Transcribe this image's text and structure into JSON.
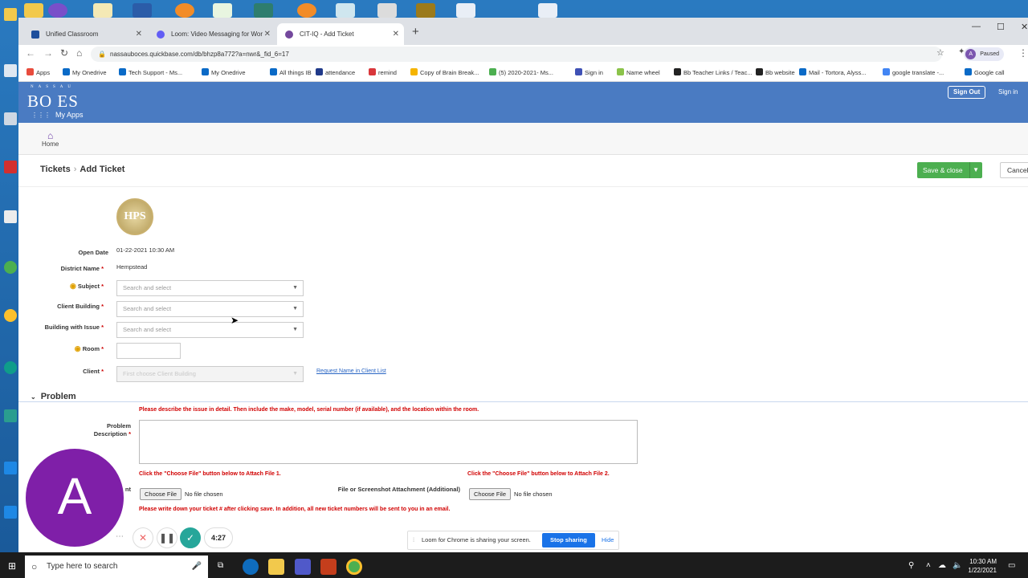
{
  "browser": {
    "tabs": [
      {
        "title": "Unified Classroom",
        "color": "#1e4f9c"
      },
      {
        "title": "Loom: Video Messaging for Wor",
        "color": "#625df5"
      },
      {
        "title": "CIT-IQ - Add Ticket",
        "color": "#74489d"
      }
    ],
    "url": "nassauboces.quickbase.com/db/bhzp8a772?a=nwr&_fid_6=17",
    "profile_initial": "A",
    "profile_label": "Paused",
    "bookmarks": [
      {
        "label": "Apps",
        "color": "#e84c3d"
      },
      {
        "label": "My Onedrive",
        "color": "#0a6ac7"
      },
      {
        "label": "Tech Support - Ms...",
        "color": "#0a6ac7"
      },
      {
        "label": "My Onedrive",
        "color": "#0a6ac7"
      },
      {
        "label": "All things IB",
        "color": "#0a6ac7"
      },
      {
        "label": "attendance",
        "color": "#203a8a"
      },
      {
        "label": "remind",
        "color": "#d9373b"
      },
      {
        "label": "Copy of Brain Break...",
        "color": "#f5b400"
      },
      {
        "label": "(5) 2020-2021- Ms...",
        "color": "#4caf50"
      },
      {
        "label": "Sign in",
        "color": "#3f51b5"
      },
      {
        "label": "Name wheel",
        "color": "#8bc34a"
      },
      {
        "label": "Bb Teacher Links / Teac...",
        "color": "#222222"
      },
      {
        "label": "Bb website",
        "color": "#222222"
      },
      {
        "label": "Mail - Tortora, Alyss...",
        "color": "#0a6ac7"
      },
      {
        "label": "google translate -...",
        "color": "#4285f4"
      },
      {
        "label": "Google call",
        "color": "#0a6ac7"
      }
    ]
  },
  "app": {
    "logo_top": "NASSAU",
    "logo": "BO  ES",
    "sign_out": "Sign Out",
    "sign_in": "Sign in",
    "my_apps": "My Apps",
    "home": "Home"
  },
  "page": {
    "breadcrumb_parent": "Tickets",
    "breadcrumb_current": "Add Ticket",
    "save_label": "Save & close",
    "cancel_label": "Cancel",
    "seal_text": "HPS"
  },
  "form": {
    "open_date_label": "Open Date",
    "open_date": "01-22-2021 10:30 AM",
    "district_label": "District Name",
    "district": "Hempstead",
    "subject_label": "Subject",
    "client_building_label": "Client Building",
    "building_issue_label": "Building with Issue",
    "room_label": "Room",
    "client_label": "Client",
    "search_placeholder": "Search and select",
    "client_placeholder": "First choose Client Building",
    "request_name": "Request Name in Client List",
    "problem_section": "Problem",
    "problem_instruction": "Please describe the issue in detail. Then include the make, model, serial number (if available), and the location within the room.",
    "problem_desc_label_1": "Problem",
    "problem_desc_label_2": "Description",
    "attach1_hint": "Click the \"Choose File\" button below to Attach File 1.",
    "attach2_hint": "Click the \"Choose File\" button below to Attach File 2.",
    "attach1_label_fragment": "nt",
    "attach2_label": "File or Screenshot Attachment (Additional)",
    "choose_file": "Choose File",
    "no_file": "No file chosen",
    "ticket_note": "Please write down your ticket # after clicking save. In addition, all new ticket numbers will be sent to you in an email."
  },
  "loom": {
    "avatar_letter": "A",
    "timer": "4:27",
    "share_text": "Loom for Chrome is sharing your screen.",
    "stop_sharing": "Stop sharing",
    "hide": "Hide"
  },
  "taskbar": {
    "search_placeholder": "Type here to search",
    "time": "10:30 AM",
    "date": "1/22/2021"
  }
}
